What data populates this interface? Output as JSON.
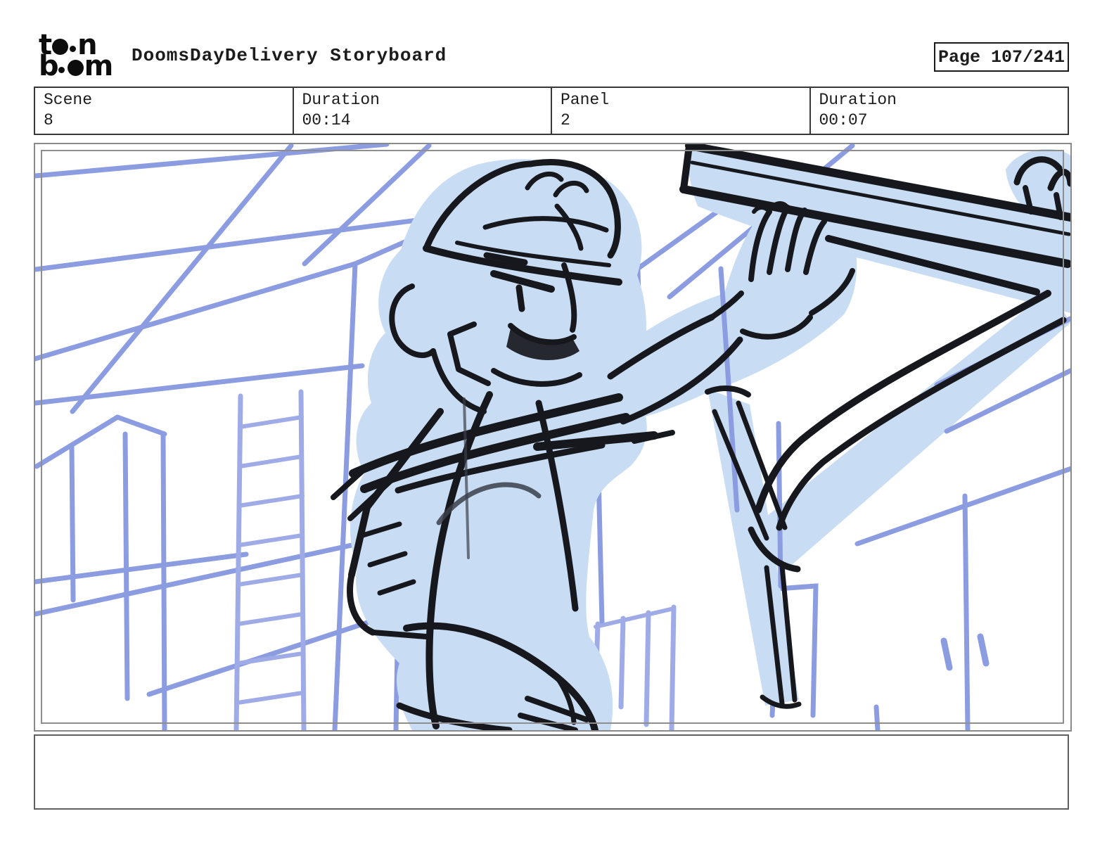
{
  "header": {
    "logo": {
      "l1a": "t",
      "l1b": "n",
      "l2a": "b",
      "l2b": "m",
      "name": "toon boom"
    },
    "title": "DoomsDayDelivery Storyboard",
    "page_label": "Page 107/241"
  },
  "info_row": {
    "cells": [
      {
        "label": "Scene",
        "value": "8"
      },
      {
        "label": "Duration",
        "value": "00:14"
      },
      {
        "label": "Panel",
        "value": "2"
      },
      {
        "label": "Duration",
        "value": "00:07"
      }
    ]
  },
  "panel": {
    "caption": ""
  },
  "colors": {
    "purple": "#8c9ce1",
    "purple_light": "#9fabe7",
    "fig_fill": "#c8ddf3",
    "ink": "#17181d",
    "border_dark": "#373737",
    "border_panel": "#8a8a8a",
    "border_caption": "#5f5f5f"
  }
}
